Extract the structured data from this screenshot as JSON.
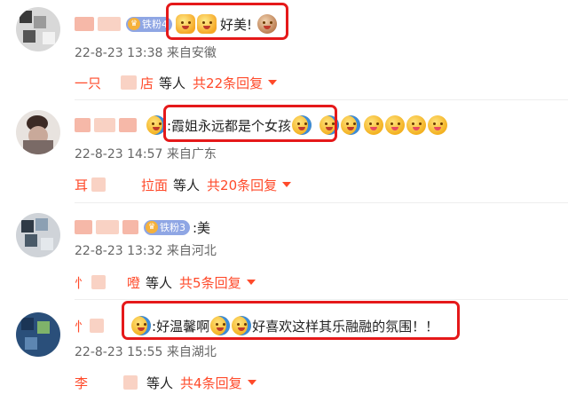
{
  "comments": [
    {
      "fan_badge": "铁粉4",
      "text": "好美!",
      "timestamp": "22-8-23 13:38",
      "location": "来自安徽",
      "reply_user_a": "一只",
      "reply_user_b": "店",
      "reply_others": "等人",
      "reply_count": "共22条回复"
    },
    {
      "fan_badge": "",
      "text": ":霞姐永远都是个女孩",
      "timestamp": "22-8-23 14:57",
      "location": "来自广东",
      "reply_user_a": "耳",
      "reply_user_b": "拉面",
      "reply_others": "等人",
      "reply_count": "共20条回复"
    },
    {
      "fan_badge": "铁粉3",
      "text": ":美",
      "timestamp": "22-8-23 13:32",
      "location": "来自河北",
      "reply_user_a": "忄",
      "reply_user_b": "噔",
      "reply_others": "等人",
      "reply_count": "共5条回复"
    },
    {
      "fan_badge": "",
      "text_a": ":好温馨啊",
      "text_b": "好喜欢这样其乐融融的氛围！！",
      "timestamp": "22-8-23 15:55",
      "location": "来自湖北",
      "reply_user_a": "李",
      "reply_user_b": "",
      "reply_others": "等人",
      "reply_count": "共4条回复"
    }
  ],
  "colors": {
    "accent": "#ff4a2a",
    "highlight_box": "#e5191a",
    "fan_badge_bg": "#8fa6e4",
    "meta_text": "#666666"
  }
}
